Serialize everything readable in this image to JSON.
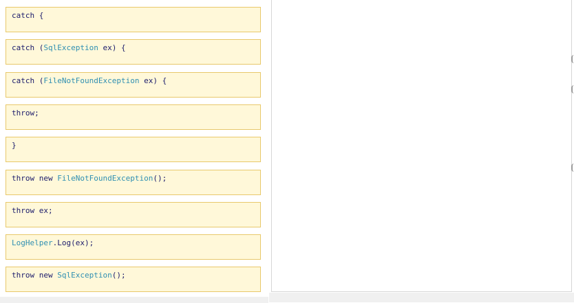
{
  "cards": [
    {
      "id": "catch",
      "tokens": [
        {
          "t": "catch",
          "k": "kw"
        },
        {
          "t": " {",
          "k": "plain"
        }
      ]
    },
    {
      "id": "catch-sqlexception",
      "tokens": [
        {
          "t": "catch",
          "k": "kw"
        },
        {
          "t": " (",
          "k": "plain"
        },
        {
          "t": "SqlException",
          "k": "type"
        },
        {
          "t": " ex) {",
          "k": "plain"
        }
      ]
    },
    {
      "id": "catch-filenotfound",
      "tokens": [
        {
          "t": "catch",
          "k": "kw"
        },
        {
          "t": " (",
          "k": "plain"
        },
        {
          "t": "FileNotFoundException",
          "k": "type"
        },
        {
          "t": " ex) {",
          "k": "plain"
        }
      ]
    },
    {
      "id": "throw",
      "tokens": [
        {
          "t": "throw",
          "k": "kw"
        },
        {
          "t": ";",
          "k": "plain"
        }
      ]
    },
    {
      "id": "close-brace",
      "tokens": [
        {
          "t": "}",
          "k": "plain"
        }
      ]
    },
    {
      "id": "throw-new-filenotfound",
      "tokens": [
        {
          "t": "throw",
          "k": "kw"
        },
        {
          "t": " new ",
          "k": "plain"
        },
        {
          "t": "FileNotFoundException",
          "k": "type"
        },
        {
          "t": "();",
          "k": "plain"
        }
      ]
    },
    {
      "id": "throw-ex",
      "tokens": [
        {
          "t": "throw",
          "k": "kw"
        },
        {
          "t": " ex;",
          "k": "plain"
        }
      ]
    },
    {
      "id": "loghelper-log",
      "tokens": [
        {
          "t": "LogHelper",
          "k": "type"
        },
        {
          "t": ".Log(ex);",
          "k": "plain"
        }
      ]
    },
    {
      "id": "throw-new-sqlexception",
      "tokens": [
        {
          "t": "throw",
          "k": "kw"
        },
        {
          "t": " new ",
          "k": "plain"
        },
        {
          "t": "SqlException",
          "k": "type"
        },
        {
          "t": "();",
          "k": "plain"
        }
      ]
    }
  ],
  "colors": {
    "card_bg": "#fff8d9",
    "card_border": "#e8c86a",
    "keyword": "#1b1b6b",
    "type": "#2f8fb2"
  }
}
